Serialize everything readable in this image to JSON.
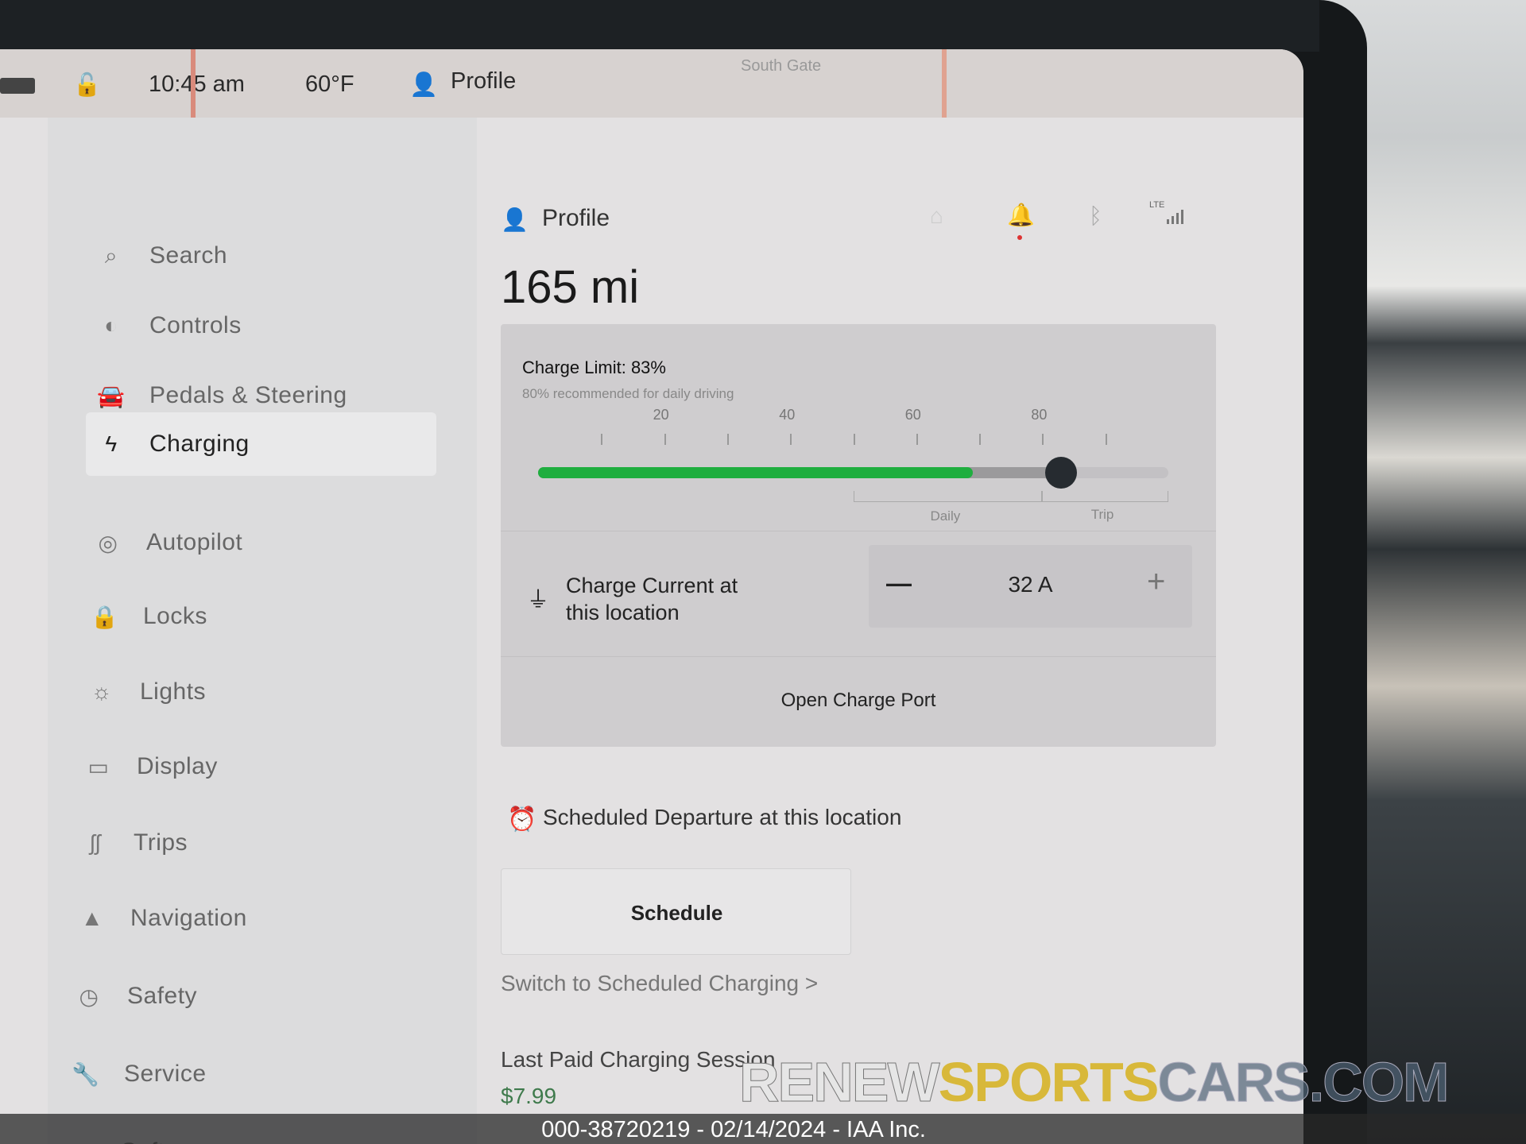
{
  "status_bar": {
    "time": "10:45 am",
    "temperature": "60°F",
    "profile_label": "Profile",
    "map_label": "South Gate"
  },
  "sidebar": {
    "items": [
      {
        "label": "Search",
        "icon": "search-icon"
      },
      {
        "label": "Controls",
        "icon": "toggle-icon"
      },
      {
        "label": "Pedals & Steering",
        "icon": "car-icon"
      },
      {
        "label": "Charging",
        "icon": "lightning-icon",
        "active": true
      },
      {
        "label": "Autopilot",
        "icon": "steering-wheel-icon"
      },
      {
        "label": "Locks",
        "icon": "lock-icon"
      },
      {
        "label": "Lights",
        "icon": "sun-icon"
      },
      {
        "label": "Display",
        "icon": "display-icon"
      },
      {
        "label": "Trips",
        "icon": "trips-icon"
      },
      {
        "label": "Navigation",
        "icon": "navigation-icon"
      },
      {
        "label": "Safety",
        "icon": "safety-icon"
      },
      {
        "label": "Service",
        "icon": "wrench-icon"
      },
      {
        "label": "Software",
        "icon": "download-icon"
      }
    ]
  },
  "header": {
    "profile_label": "Profile",
    "signal": "LTE"
  },
  "charging": {
    "range": "165 mi",
    "charge_limit_label": "Charge Limit: 83%",
    "charge_limit_percent": 83,
    "current_charge_percent": 69,
    "recommendation": "80% recommended for daily driving",
    "ticks": [
      "20",
      "40",
      "60",
      "80"
    ],
    "daily_label": "Daily",
    "trip_label": "Trip",
    "current_label_line1": "Charge Current at",
    "current_label_line2": "this location",
    "current_value": "32 A",
    "minus": "—",
    "plus": "+",
    "open_port": "Open Charge Port",
    "scheduled_departure": "Scheduled Departure at this location",
    "schedule_button": "Schedule",
    "switch_link": "Switch to Scheduled Charging >",
    "last_paid_label": "Last Paid Charging Session",
    "last_paid_value": "$7.99",
    "accent": "#1fae3f"
  },
  "watermark": {
    "part1": "RENEW",
    "part2": "SPORTS",
    "part3": "CARS.COM"
  },
  "footer": {
    "caption": "000-38720219 - 02/14/2024 - IAA Inc."
  }
}
